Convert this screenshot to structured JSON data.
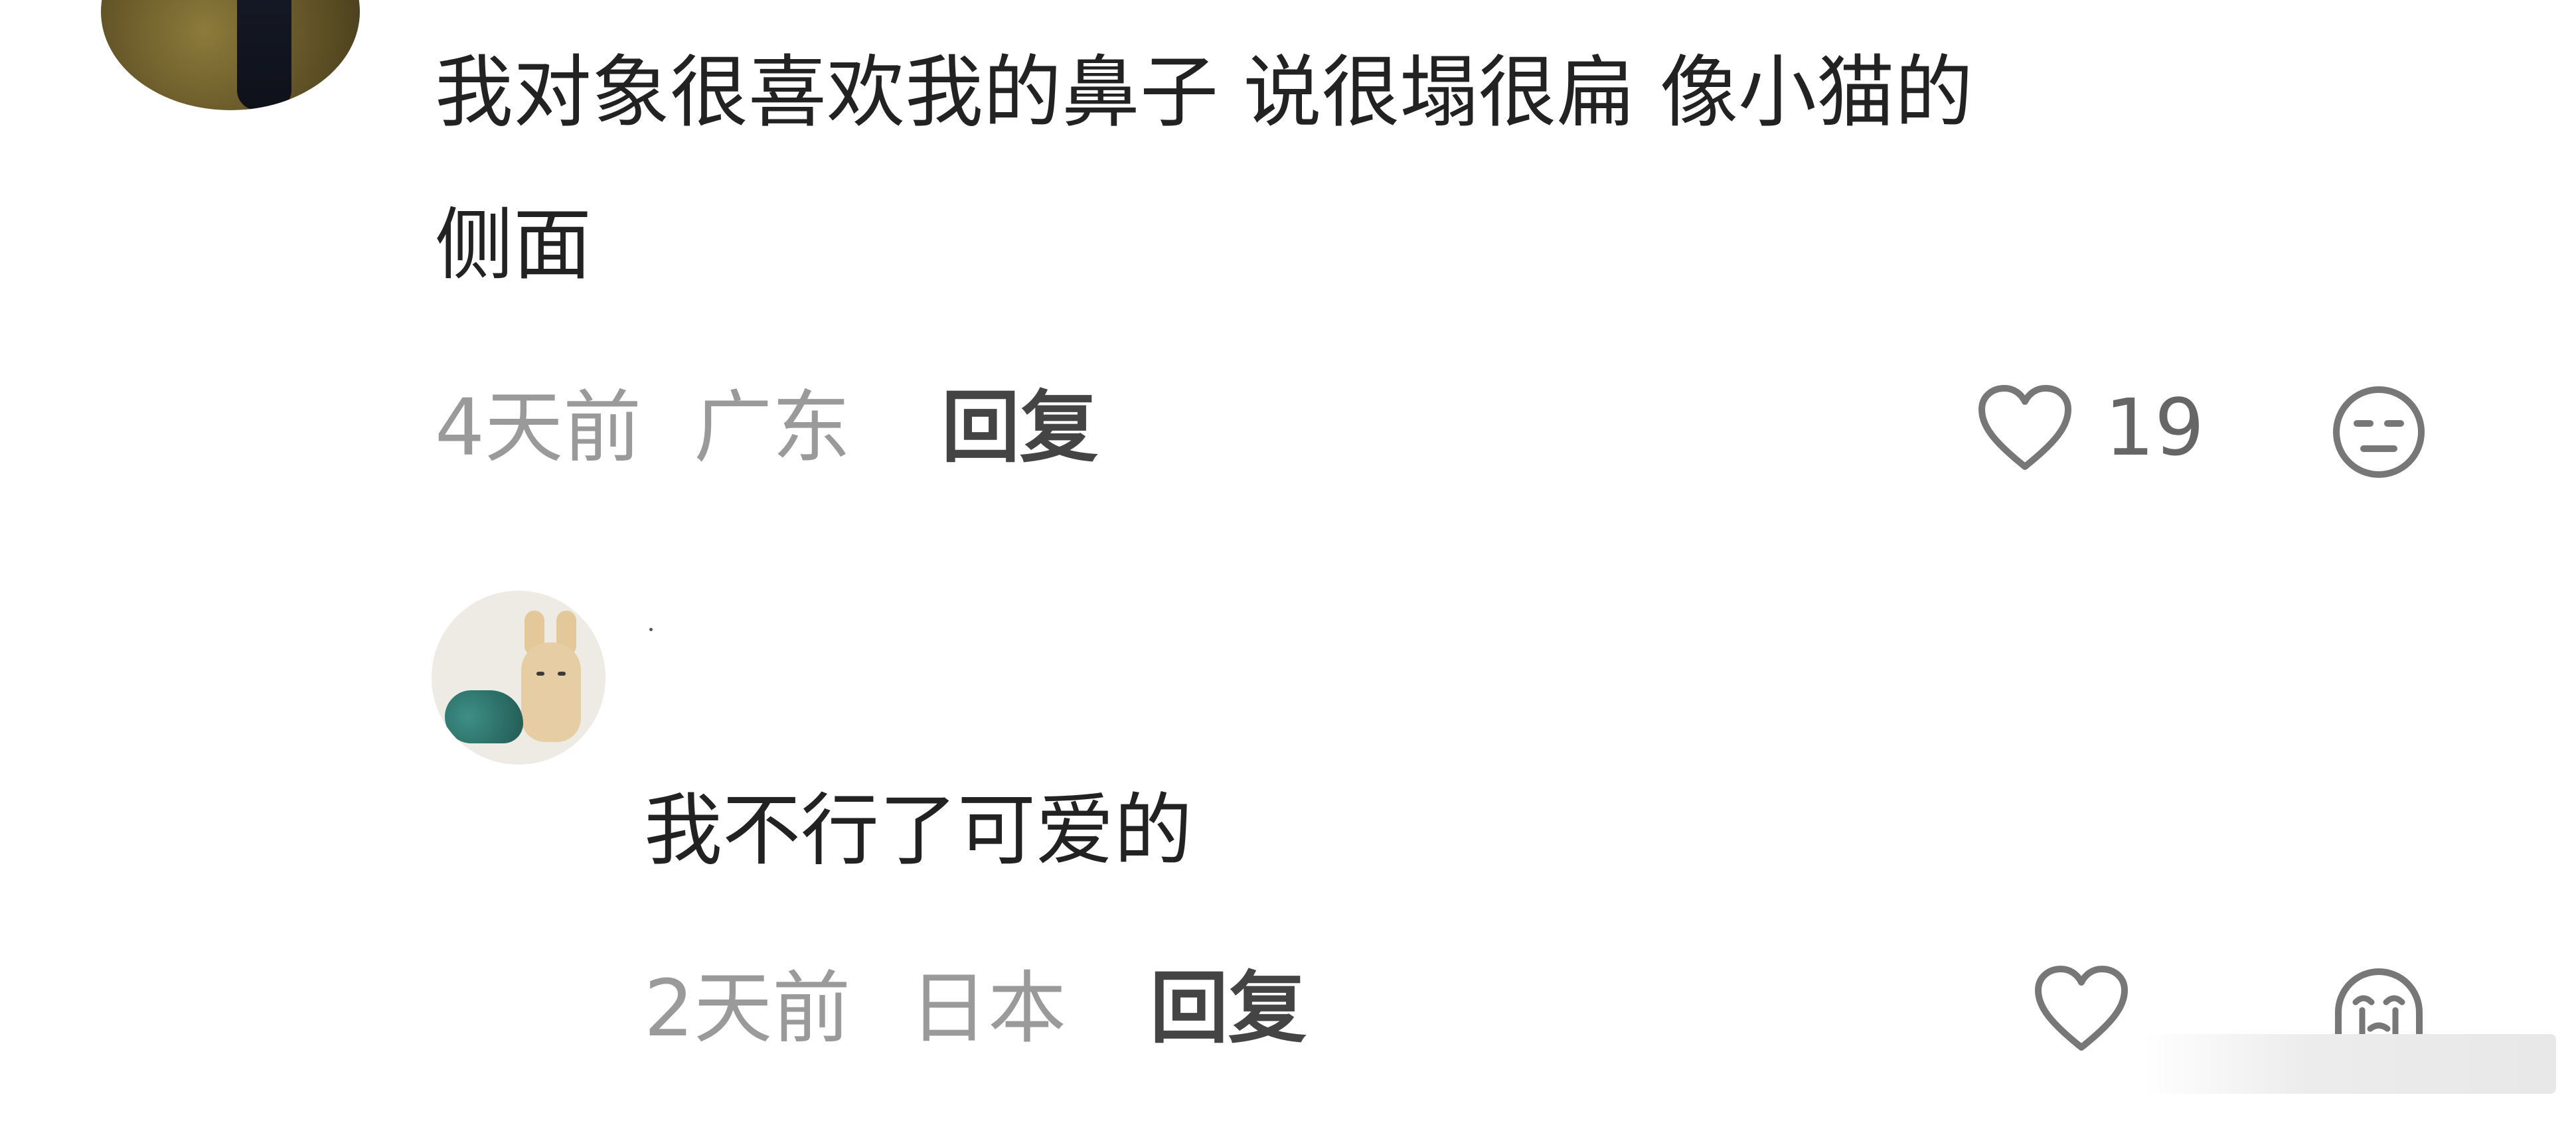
{
  "comment": {
    "text_line1": "我对象很喜欢我的鼻子 说很塌很扁 像小猫的",
    "text_line2": "侧面",
    "time": "4天前",
    "location": "广东",
    "reply_label": "回复",
    "like_count": "19",
    "like_icon": "heart-outline-icon",
    "dislike_icon": "unamused-face-icon"
  },
  "reply": {
    "text": "我不行了可爱的",
    "time": "2天前",
    "location": "日本",
    "reply_label": "回复",
    "like_icon": "heart-outline-icon",
    "reaction_icon": "crying-face-icon"
  },
  "colors": {
    "text_primary": "#222222",
    "text_meta": "#9a9a9a",
    "text_reply_button": "#444444",
    "icon_stroke": "#777777",
    "background": "#ffffff"
  }
}
